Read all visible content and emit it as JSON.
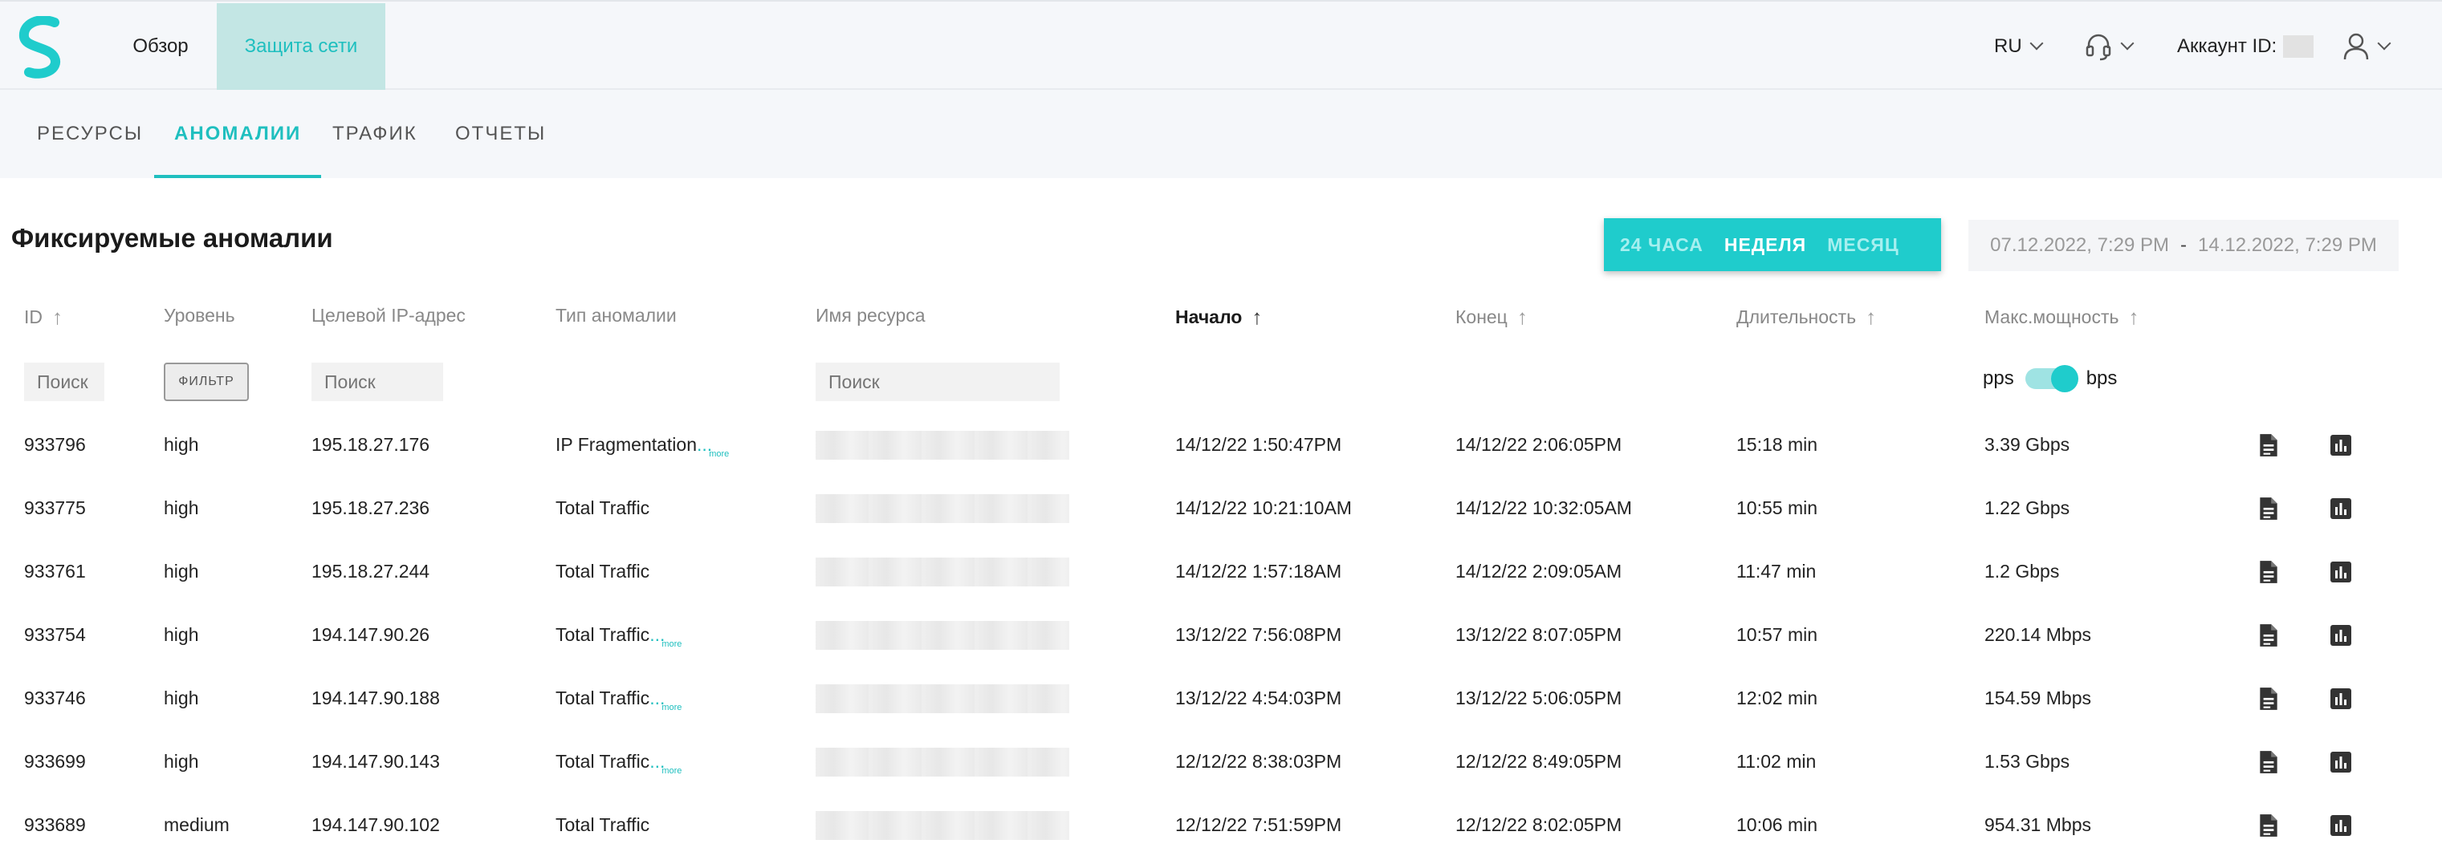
{
  "nav": {
    "overview": "Обзор",
    "protection": "Защита сети",
    "lang": "RU",
    "account_label": "Аккаунт ID:"
  },
  "tabs": [
    "РЕСУРСЫ",
    "АНОМАЛИИ",
    "ТРАФИК",
    "ОТЧЕТЫ"
  ],
  "page": {
    "title": "Фиксируемые аномалии",
    "periods": [
      "24 ЧАСА",
      "НЕДЕЛЯ",
      "МЕСЯЦ"
    ],
    "active_period": "НЕДЕЛЯ",
    "date_from": "07.12.2022, 7:29 PM",
    "date_sep": "-",
    "date_to": "14.12.2022, 7:29 PM"
  },
  "table": {
    "headers": {
      "id": "ID",
      "level": "Уровень",
      "ip": "Целевой IP-адрес",
      "type": "Тип аномалии",
      "resource": "Имя ресурса",
      "start": "Начало",
      "end": "Конец",
      "duration": "Длительность",
      "max": "Макс.мощность"
    },
    "filters": {
      "id_placeholder": "Поиск",
      "level_button": "ФИЛЬТР",
      "ip_placeholder": "Поиск",
      "resource_placeholder": "Поиск",
      "unit_left": "pps",
      "unit_right": "bps"
    },
    "more_label": "more",
    "rows": [
      {
        "id": "933796",
        "level": "high",
        "ip": "195.18.27.176",
        "type": "IP Fragmentation",
        "more": true,
        "start": "14/12/22 1:50:47PM",
        "end": "14/12/22 2:06:05PM",
        "duration": "15:18 min",
        "max": "3.39 Gbps"
      },
      {
        "id": "933775",
        "level": "high",
        "ip": "195.18.27.236",
        "type": "Total Traffic",
        "more": false,
        "start": "14/12/22 10:21:10AM",
        "end": "14/12/22 10:32:05AM",
        "duration": "10:55 min",
        "max": "1.22 Gbps"
      },
      {
        "id": "933761",
        "level": "high",
        "ip": "195.18.27.244",
        "type": "Total Traffic",
        "more": false,
        "start": "14/12/22 1:57:18AM",
        "end": "14/12/22 2:09:05AM",
        "duration": "11:47 min",
        "max": "1.2 Gbps"
      },
      {
        "id": "933754",
        "level": "high",
        "ip": "194.147.90.26",
        "type": "Total Traffic",
        "more": true,
        "start": "13/12/22 7:56:08PM",
        "end": "13/12/22 8:07:05PM",
        "duration": "10:57 min",
        "max": "220.14 Mbps"
      },
      {
        "id": "933746",
        "level": "high",
        "ip": "194.147.90.188",
        "type": "Total Traffic",
        "more": true,
        "start": "13/12/22 4:54:03PM",
        "end": "13/12/22 5:06:05PM",
        "duration": "12:02 min",
        "max": "154.59 Mbps"
      },
      {
        "id": "933699",
        "level": "high",
        "ip": "194.147.90.143",
        "type": "Total Traffic",
        "more": true,
        "start": "12/12/22 8:38:03PM",
        "end": "12/12/22 8:49:05PM",
        "duration": "11:02 min",
        "max": "1.53 Gbps"
      },
      {
        "id": "933689",
        "level": "medium",
        "ip": "194.147.90.102",
        "type": "Total Traffic",
        "more": false,
        "start": "12/12/22 7:51:59PM",
        "end": "12/12/22 8:02:05PM",
        "duration": "10:06 min",
        "max": "954.31 Mbps"
      }
    ]
  },
  "colors": {
    "accent": "#1fcccc",
    "accent_text": "#1fbfbf"
  }
}
